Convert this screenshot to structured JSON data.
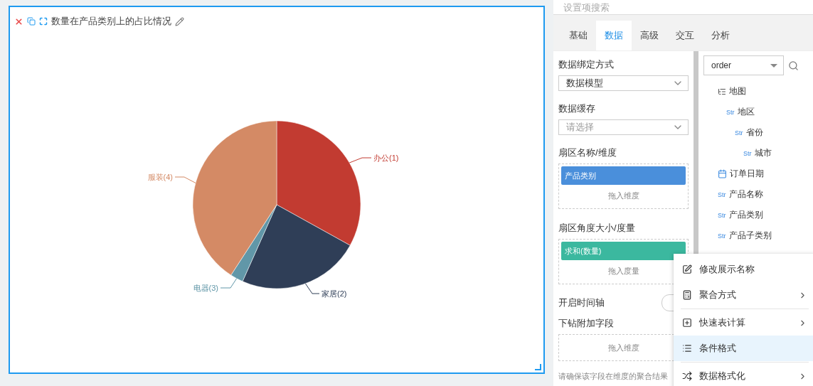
{
  "chart_card": {
    "title": "数量在产品类别上的占比情况",
    "slices": [
      {
        "label": "办公(1)",
        "color": "#c23b31"
      },
      {
        "label": "家居(2)",
        "color": "#2f3e57"
      },
      {
        "label": "电器(3)",
        "color": "#6197a8"
      },
      {
        "label": "服装(4)",
        "color": "#d48a65"
      }
    ]
  },
  "settings": {
    "search": {
      "placeholder": "设置项搜索"
    },
    "tabs": [
      {
        "label": "基础",
        "selected": false
      },
      {
        "label": "数据",
        "selected": true
      },
      {
        "label": "高级",
        "selected": false
      },
      {
        "label": "交互",
        "selected": false
      },
      {
        "label": "分析",
        "selected": false
      }
    ],
    "binding_label": "数据绑定方式",
    "binding_value": "数据模型",
    "cache_label": "数据缓存",
    "cache_placeholder": "请选择",
    "dimension_label": "扇区名称/维度",
    "dimension_chip": "产品类别",
    "dimension_drop": "拖入维度",
    "measure_label": "扇区角度大小/度量",
    "measure_chip": "求和(数量)",
    "measure_drop": "拖入度量",
    "timeline_label": "开启时间轴",
    "timeline_on": false,
    "drill_label": "下钻附加字段",
    "drill_drop": "拖入维度",
    "help_text": "请确保该字段在维度的聚合结果"
  },
  "fields": {
    "source": "order",
    "items": [
      {
        "kind": "tree",
        "name": "地图",
        "children": [
          {
            "kind": "str",
            "tag": "Str",
            "name": "地区",
            "children": [
              {
                "kind": "str",
                "tag": "Str",
                "name": "省份",
                "children": [
                  {
                    "kind": "str",
                    "tag": "Str",
                    "name": "城市"
                  }
                ]
              }
            ]
          }
        ]
      },
      {
        "kind": "date",
        "name": "订单日期"
      },
      {
        "kind": "str",
        "tag": "Str",
        "name": "产品名称"
      },
      {
        "kind": "str",
        "tag": "Str",
        "name": "产品类别"
      },
      {
        "kind": "str",
        "tag": "Str",
        "name": "产品子类别"
      }
    ]
  },
  "context_menu": [
    {
      "kind": "edit",
      "label": "修改展示名称",
      "submenu": false,
      "selected": false,
      "divider_after": false
    },
    {
      "kind": "calc",
      "label": "聚合方式",
      "submenu": true,
      "selected": false,
      "divider_after": true
    },
    {
      "kind": "plus",
      "label": "快速表计算",
      "submenu": true,
      "selected": false,
      "divider_after": false
    },
    {
      "kind": "list",
      "label": "条件格式",
      "submenu": false,
      "selected": true,
      "divider_after": true
    },
    {
      "kind": "shuffle",
      "label": "数据格式化",
      "submenu": true,
      "selected": false,
      "divider_after": false
    }
  ]
}
